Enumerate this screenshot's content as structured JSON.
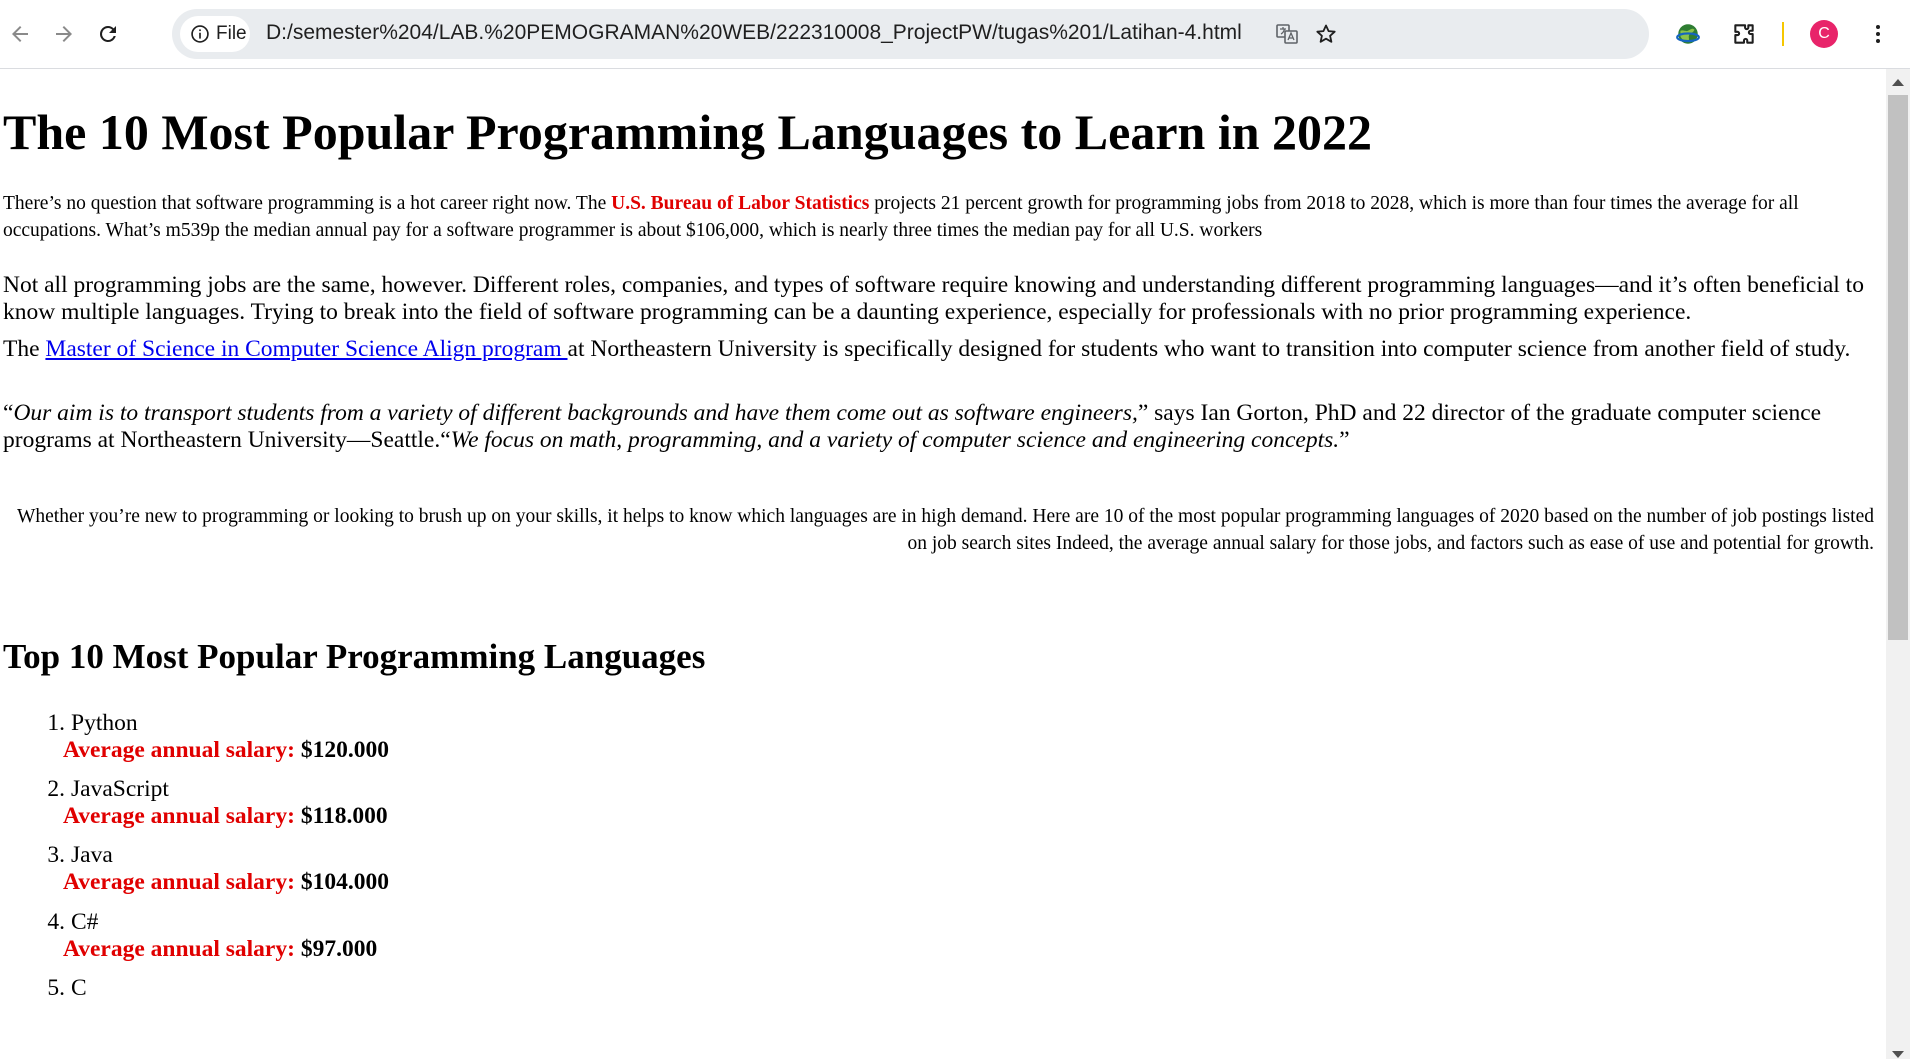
{
  "browser": {
    "file_label": "File",
    "url": "D:/semester%204/LAB.%20PEMOGRAMAN%20WEB/222310008_ProjectPW/tugas%201/Latihan-4.html",
    "avatar_letter": "C",
    "avatar_color": "#e8246a",
    "icons": [
      "back-icon",
      "forward-icon",
      "reload-icon",
      "info-icon",
      "translate-icon",
      "bookmark-star-icon",
      "extension-globe-icon",
      "puzzle-icon",
      "menu-dots-icon"
    ]
  },
  "article": {
    "title": "The 10 Most Popular Programming Languages to Learn in 2022",
    "intro": {
      "before": "There’s no question that software programming is a hot career right now. The ",
      "highlight": "U.S. Bureau of Labor Statistics",
      "after": " projects 21 percent growth for programming jobs from 2018 to 2028, which is more than four times the average for all occupations. What’s m539p the median annual pay for a software programmer is about $106,000, which is nearly three times the median pay for all U.S. workers"
    },
    "para2": "Not all programming jobs are the same, however. Different roles, companies, and types of software require knowing and understanding different programming languages—and it’s often beneficial to know multiple languages. Trying to break into the field of software programming can be a daunting experience, especially for professionals with no prior programming experience.",
    "para3": {
      "before": "The ",
      "link": "Master of Science in Computer Science Align program ",
      "after": "at Northeastern University is specifically designed for students who want to transition into computer science from another field of study."
    },
    "quote": {
      "open1": "“",
      "italic1": "Our aim is to transport students from a variety of different backgrounds and have them come out as software engineers,",
      "middle": "” says Ian Gorton, PhD and 22 director of the graduate computer science programs at Northeastern University—Seattle.“",
      "italic2": "We focus on math, programming, and a variety of computer science and engineering concepts.",
      "close": "”"
    },
    "para5": "Whether you’re new to programming or looking to brush up on your skills, it helps to know which languages are in high demand. Here are 10 of the most popular programming languages of 2020 based on the number of job postings listed on job search sites Indeed, the average annual salary for those jobs, and factors such as ease of use and potential for growth.",
    "subtitle": "Top 10 Most Popular Programming Languages",
    "salary_label": "Average annual salary:",
    "languages": [
      {
        "num": "1.",
        "name": "Python",
        "salary": "$120.000"
      },
      {
        "num": "2.",
        "name": "JavaScript",
        "salary": "$118.000"
      },
      {
        "num": "3.",
        "name": "Java",
        "salary": "$104.000"
      },
      {
        "num": "4.",
        "name": "C#",
        "salary": "$97.000"
      },
      {
        "num": "5.",
        "name": "C",
        "salary": ""
      }
    ]
  },
  "colors": {
    "highlight_red": "#e00000",
    "link_blue": "#0000ee",
    "omnibox_bg": "#e9ecef"
  }
}
